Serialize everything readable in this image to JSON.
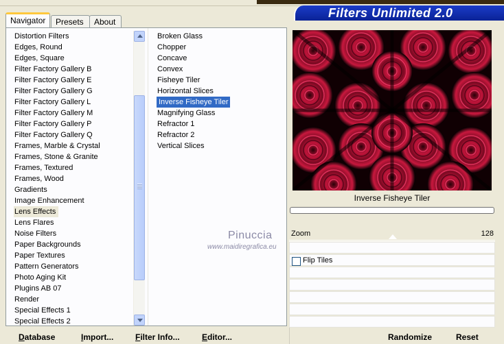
{
  "tabs": [
    "Navigator",
    "Presets",
    "About"
  ],
  "banner_title": "Filters Unlimited 2.0",
  "categories": [
    "Distortion Filters",
    "Edges, Round",
    "Edges, Square",
    "Filter Factory Gallery B",
    "Filter Factory Gallery E",
    "Filter Factory Gallery G",
    "Filter Factory Gallery L",
    "Filter Factory Gallery M",
    "Filter Factory Gallery P",
    "Filter Factory Gallery Q",
    "Frames, Marble & Crystal",
    "Frames, Stone & Granite",
    "Frames, Textured",
    "Frames, Wood",
    "Gradients",
    "Image Enhancement",
    "Lens Effects",
    "Lens Flares",
    "Noise Filters",
    "Paper Backgrounds",
    "Paper Textures",
    "Pattern Generators",
    "Photo Aging Kit",
    "Plugins AB 07",
    "Render",
    "Special Effects 1",
    "Special Effects 2"
  ],
  "selected_category": "Lens Effects",
  "filters": [
    "Broken Glass",
    "Chopper",
    "Concave",
    "Convex",
    "Fisheye Tiler",
    "Horizontal Slices",
    "Inverse Fisheye Tiler",
    "Magnifying Glass",
    "Refractor 1",
    "Refractor 2",
    "Vertical Slices"
  ],
  "selected_filter": "Inverse Fisheye Tiler",
  "preview_caption": "Inverse Fisheye Tiler",
  "params": {
    "zoom_label": "Zoom",
    "zoom_value": "128",
    "flip_tiles_label": "Flip Tiles",
    "flip_tiles_checked": false
  },
  "watermark": {
    "name": "Pinuccia",
    "url": "www.maidiregrafica.eu"
  },
  "buttons": {
    "database": "Database",
    "import": "Import...",
    "filter_info": "Filter Info...",
    "editor": "Editor...",
    "randomize": "Randomize",
    "reset": "Reset"
  },
  "colors": {
    "selection": "#316ac5",
    "banner": "#0a2296",
    "preview_accent": "#a0102a"
  }
}
